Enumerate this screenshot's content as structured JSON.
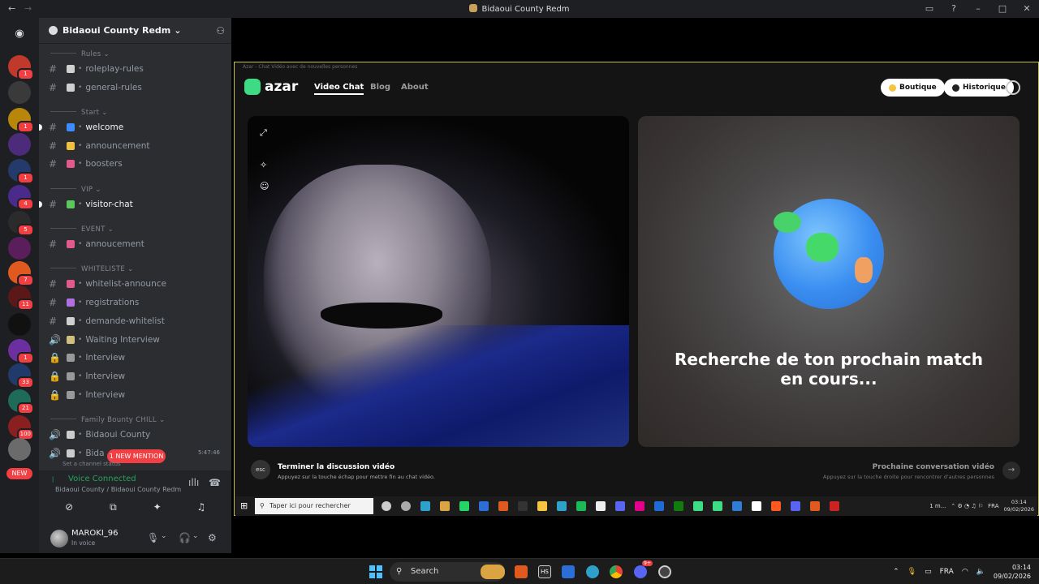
{
  "window": {
    "title": "Bidaoui County Redm"
  },
  "server_rail": {
    "new_label": "NEW",
    "servers": [
      {
        "badge": "1",
        "color": "#c0392b"
      },
      {
        "badge": "",
        "color": "#3a3a3a"
      },
      {
        "badge": "1",
        "color": "#b8860b"
      },
      {
        "badge": "",
        "color": "#4b2b7a"
      },
      {
        "badge": "1",
        "color": "#243a6b"
      },
      {
        "badge": "4",
        "color": "#4a2a8a"
      },
      {
        "badge": "5",
        "color": "#2b2b2b"
      },
      {
        "badge": "",
        "color": "#5a1f5a"
      },
      {
        "badge": "7",
        "color": "#e05a20"
      },
      {
        "badge": "11",
        "color": "#5a1818"
      },
      {
        "badge": "",
        "color": "#111111"
      },
      {
        "badge": "1",
        "color": "#6b2fa0"
      },
      {
        "badge": "33",
        "color": "#1f3a6b"
      },
      {
        "badge": "21",
        "color": "#1f6b5a"
      },
      {
        "badge": "100",
        "color": "#8a1f1f"
      },
      {
        "badge": "",
        "color": "#6b6b6b"
      }
    ]
  },
  "channels": {
    "server_name": "Bidaoui County Redm",
    "items": [
      {
        "kind": "cat",
        "label": "Rules"
      },
      {
        "kind": "ch",
        "icon_color": "#d0d0d0",
        "label": "roleplay-rules"
      },
      {
        "kind": "ch",
        "icon_color": "#d0d0d0",
        "label": "general-rules"
      },
      {
        "kind": "cat",
        "label": "Start"
      },
      {
        "kind": "ch",
        "icon_color": "#3d8bfd",
        "label": "welcome",
        "active": true
      },
      {
        "kind": "ch",
        "icon_color": "#f0c040",
        "label": "announcement"
      },
      {
        "kind": "ch",
        "icon_color": "#e05a8a",
        "label": "boosters"
      },
      {
        "kind": "cat",
        "label": "VIP"
      },
      {
        "kind": "ch",
        "icon_color": "#5ac85a",
        "label": "visitor-chat",
        "active": true
      },
      {
        "kind": "cat",
        "label": "EVENT"
      },
      {
        "kind": "ch",
        "icon_color": "#e05a8a",
        "label": "annoucement"
      },
      {
        "kind": "cat",
        "label": "WHITELISTE"
      },
      {
        "kind": "ch",
        "icon_color": "#e05a8a",
        "label": "whitelist-announce"
      },
      {
        "kind": "ch",
        "icon_color": "#b070e0",
        "label": "registrations"
      },
      {
        "kind": "ch",
        "icon_color": "#d0d0d0",
        "label": "demande-whitelist"
      },
      {
        "kind": "voice",
        "icon_color": "#d0c080",
        "label": "Waiting Interview"
      },
      {
        "kind": "lock",
        "icon_color": "#999999",
        "label": "Interview"
      },
      {
        "kind": "lock",
        "icon_color": "#999999",
        "label": "Interview"
      },
      {
        "kind": "lock",
        "icon_color": "#999999",
        "label": "Interview"
      },
      {
        "kind": "cat",
        "label": "Family Bounty CHILL"
      },
      {
        "kind": "voice",
        "icon_color": "#cccccc",
        "label": "Bidaoui County"
      },
      {
        "kind": "voice-active",
        "icon_color": "#cccccc",
        "label": "Bida"
      }
    ],
    "timer": "5:47:46",
    "mention_label": "1 NEW MENTION",
    "channel_status": "Set a channel status"
  },
  "voice_panel": {
    "title": "Voice Connected",
    "subtitle": "Bidaoui County / Bidaoui County Redm"
  },
  "user_panel": {
    "username": "MAROKI_96",
    "status": "In voice"
  },
  "stream": {
    "window_caption": "Azar - Chat Vidéo avec de nouvelles personnes",
    "brand": "azar",
    "nav": [
      "Video Chat",
      "Blog",
      "About"
    ],
    "boutique_label": "Boutique",
    "historique_label": "Historique",
    "search_message": "Recherche de ton prochain match en cours...",
    "esc_label": "esc",
    "end_title": "Terminer la discussion vidéo",
    "end_sub": "Appuyez sur la touche échap pour mettre fin au chat vidéo.",
    "next_title": "Prochaine conversation vidéo",
    "next_sub": "Appuyez sur la touche droite pour rencontrer d'autres personnes"
  },
  "inner_taskbar": {
    "search_placeholder": "Taper ici pour rechercher",
    "tray_text": "1 m...",
    "lang": "FRA",
    "time": "03:14",
    "date": "09/02/2026"
  },
  "os_taskbar": {
    "search_label": "Search",
    "lang": "FRA",
    "time": "03:14",
    "date": "09/02/2026",
    "badge": "9+"
  }
}
